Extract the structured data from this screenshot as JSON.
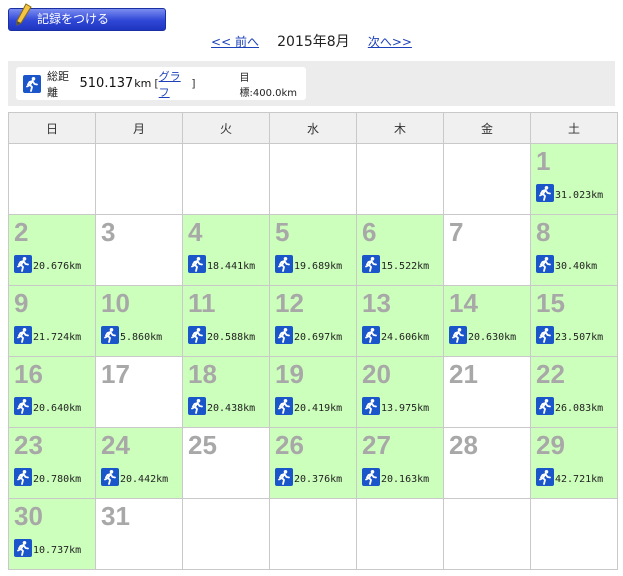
{
  "header": {
    "record_label": "記録をつける"
  },
  "nav": {
    "prev_label": "<< 前へ",
    "current_month": "2015年8月",
    "next_label": "次へ>>"
  },
  "summary": {
    "total_label": "総距離",
    "total_value": "510.137",
    "total_unit": "km",
    "graph_label": "グラフ",
    "goal_label": "目標:400.0km"
  },
  "calendar": {
    "weekdays": [
      "日",
      "月",
      "火",
      "水",
      "木",
      "金",
      "土"
    ],
    "weeks": [
      [
        {
          "day": "",
          "dist": ""
        },
        {
          "day": "",
          "dist": ""
        },
        {
          "day": "",
          "dist": ""
        },
        {
          "day": "",
          "dist": ""
        },
        {
          "day": "",
          "dist": ""
        },
        {
          "day": "",
          "dist": ""
        },
        {
          "day": "1",
          "dist": "31.023km"
        }
      ],
      [
        {
          "day": "2",
          "dist": "20.676km"
        },
        {
          "day": "3",
          "dist": ""
        },
        {
          "day": "4",
          "dist": "18.441km"
        },
        {
          "day": "5",
          "dist": "19.689km"
        },
        {
          "day": "6",
          "dist": "15.522km"
        },
        {
          "day": "7",
          "dist": ""
        },
        {
          "day": "8",
          "dist": "30.40km"
        }
      ],
      [
        {
          "day": "9",
          "dist": "21.724km"
        },
        {
          "day": "10",
          "dist": "5.860km"
        },
        {
          "day": "11",
          "dist": "20.588km"
        },
        {
          "day": "12",
          "dist": "20.697km"
        },
        {
          "day": "13",
          "dist": "24.606km"
        },
        {
          "day": "14",
          "dist": "20.630km"
        },
        {
          "day": "15",
          "dist": "23.507km"
        }
      ],
      [
        {
          "day": "16",
          "dist": "20.640km"
        },
        {
          "day": "17",
          "dist": ""
        },
        {
          "day": "18",
          "dist": "20.438km"
        },
        {
          "day": "19",
          "dist": "20.419km"
        },
        {
          "day": "20",
          "dist": "13.975km"
        },
        {
          "day": "21",
          "dist": ""
        },
        {
          "day": "22",
          "dist": "26.083km"
        }
      ],
      [
        {
          "day": "23",
          "dist": "20.780km"
        },
        {
          "day": "24",
          "dist": "20.442km"
        },
        {
          "day": "25",
          "dist": ""
        },
        {
          "day": "26",
          "dist": "20.376km"
        },
        {
          "day": "27",
          "dist": "20.163km"
        },
        {
          "day": "28",
          "dist": ""
        },
        {
          "day": "29",
          "dist": "42.721km"
        }
      ],
      [
        {
          "day": "30",
          "dist": "10.737km"
        },
        {
          "day": "31",
          "dist": ""
        },
        {
          "day": "",
          "dist": ""
        },
        {
          "day": "",
          "dist": ""
        },
        {
          "day": "",
          "dist": ""
        },
        {
          "day": "",
          "dist": ""
        },
        {
          "day": "",
          "dist": ""
        }
      ]
    ]
  },
  "colors": {
    "run_day_bg": "#ccffbb",
    "icon_bg": "#1a55c9",
    "link": "#1d41b8",
    "button": "#2f47d6"
  }
}
